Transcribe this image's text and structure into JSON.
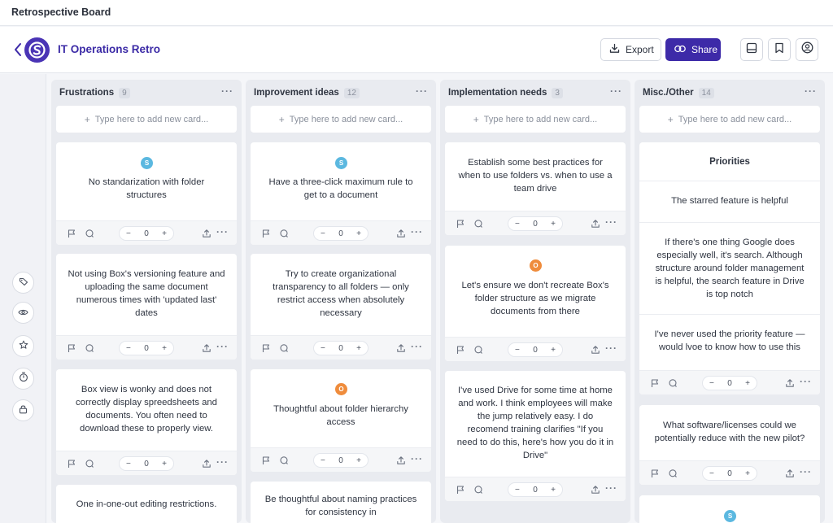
{
  "app": {
    "title": "Retrospective Board"
  },
  "header": {
    "board_title": "IT Operations Retro",
    "export_label": "Export",
    "share_label": "Share"
  },
  "columns": [
    {
      "title": "Frustrations",
      "count": "9",
      "add_placeholder": "Type here to add new card...",
      "cards": [
        {
          "avatar": "S",
          "text": "No standarization with folder structures",
          "votes": "0"
        },
        {
          "text": "Not using Box's versioning feature and uploading the same document numerous times with 'updated last' dates",
          "votes": "0"
        },
        {
          "text": "Box view is wonky and does not correctly display spreedsheets and documents. You often need to download these to properly view.",
          "votes": "0"
        },
        {
          "text": "One in-one-out editing restrictions."
        }
      ]
    },
    {
      "title": "Improvement ideas",
      "count": "12",
      "add_placeholder": "Type here to add new card...",
      "cards": [
        {
          "avatar": "S",
          "text": "Have a three-click maximum rule to get to a document",
          "votes": "0"
        },
        {
          "text": "Try to create organizational transparency to all folders — only restrict access when absolutely necessary",
          "votes": "0"
        },
        {
          "avatar": "O",
          "text": "Thoughtful about folder hierarchy access",
          "votes": "0"
        },
        {
          "text": "Be thoughtful about naming practices for consistency in"
        }
      ]
    },
    {
      "title": "Implementation needs",
      "count": "3",
      "add_placeholder": "Type here to add new card...",
      "cards": [
        {
          "text": "Establish some best practices for when to use folders vs. when to use a team drive",
          "votes": "0"
        },
        {
          "avatar": "O",
          "text": "Let's ensure we don't recreate Box's folder structure as we migrate documents from there",
          "votes": "0"
        },
        {
          "text": "I've used Drive for some time at home and work. I think employees will make the jump relatively easy. I do recomend training clarifies \"If you need to do this, here's how you do it in Drive\"",
          "votes": "0"
        }
      ]
    },
    {
      "title": "Misc./Other",
      "count": "14",
      "add_placeholder": "Type here to add new card...",
      "group_title": "Priorities",
      "group_items": [
        "The starred feature is helpful",
        "If there's one thing Google does especially well, it's search. Although structure around folder management is helpful, the search feature in Drive is top notch",
        "I've never used the priority feature — would lvoe to know how to use this"
      ],
      "group_votes": "0",
      "cards": [
        {
          "text": "What software/licenses could we potentially reduce with the new pilot?",
          "votes": "0"
        },
        {
          "avatar": "S"
        }
      ]
    }
  ],
  "icons": {
    "back": "chevron-left-icon",
    "logo": "logo-icon",
    "export": "download-icon",
    "share": "link-icon",
    "panel": "inbox-icon",
    "bookmark": "bookmark-icon",
    "account": "user-circle-icon",
    "rail": [
      "tag-icon",
      "eye-icon",
      "star-icon",
      "timer-icon",
      "lock-icon"
    ],
    "card_footer": [
      "flag-icon",
      "comment-icon",
      "upload-icon",
      "more-icon"
    ]
  },
  "colors": {
    "accent": "#3d2aa8",
    "avatar_s": "#5bb8e0",
    "avatar_o": "#ef8c3c"
  }
}
